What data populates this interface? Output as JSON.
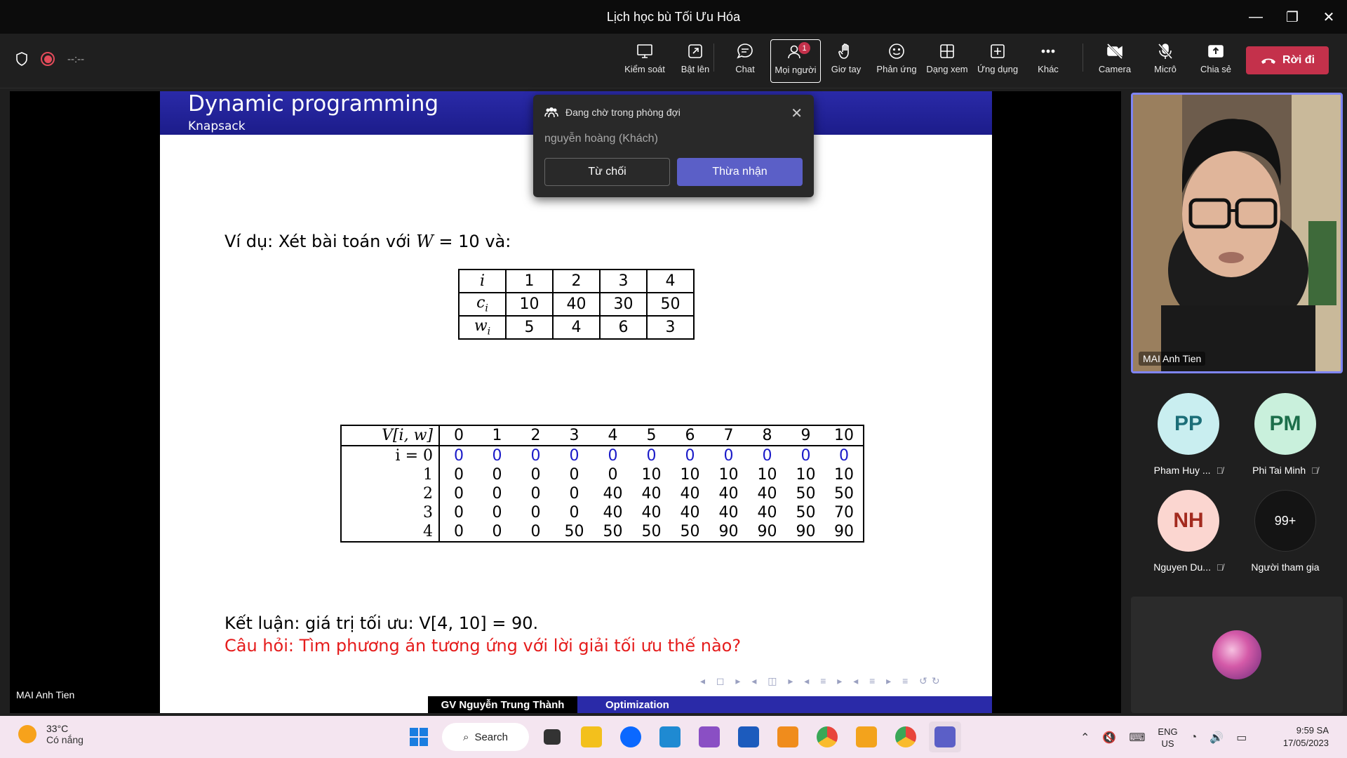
{
  "window": {
    "title": "Lịch học bù Tối Ưu Hóa",
    "controls": [
      "minimize-icon",
      "restore-icon",
      "close-icon"
    ]
  },
  "toolbar": {
    "timer": "--:--",
    "items": [
      {
        "label": "Kiểm soát",
        "icon": "control-icon"
      },
      {
        "label": "Bật lên",
        "icon": "popout-icon"
      },
      {
        "label": "Chat",
        "icon": "chat-icon"
      },
      {
        "label": "Mọi người",
        "icon": "people-icon",
        "badge": "1"
      },
      {
        "label": "Giơ tay",
        "icon": "raise-hand-icon"
      },
      {
        "label": "Phản ứng",
        "icon": "reactions-icon"
      },
      {
        "label": "Dạng xem",
        "icon": "view-icon"
      },
      {
        "label": "Ứng dụng",
        "icon": "apps-icon"
      },
      {
        "label": "Khác",
        "icon": "more-icon"
      },
      {
        "label": "Camera",
        "icon": "camera-off-icon"
      },
      {
        "label": "Micrô",
        "icon": "mic-off-icon"
      },
      {
        "label": "Chia sẻ",
        "icon": "share-icon"
      }
    ],
    "leave_label": "Rời đi",
    "colors": {
      "leave": "#c4314b",
      "active_border": "#ffffff"
    }
  },
  "slide": {
    "title": "Dynamic programming",
    "subtitle": "Knapsack",
    "example_prefix": "Ví dụ: Xét bài toán với ",
    "example_var": "W",
    "example_suffix": " = 10 và:",
    "items_table": {
      "rows": [
        {
          "head": "i",
          "cells": [
            "1",
            "2",
            "3",
            "4"
          ]
        },
        {
          "head": "c",
          "sub": "i",
          "cells": [
            "10",
            "40",
            "30",
            "50"
          ]
        },
        {
          "head": "w",
          "sub": "i",
          "cells": [
            "5",
            "4",
            "6",
            "3"
          ]
        }
      ]
    },
    "dp_table": {
      "corner": "V[i, w]",
      "columns": [
        "0",
        "1",
        "2",
        "3",
        "4",
        "5",
        "6",
        "7",
        "8",
        "9",
        "10"
      ],
      "rows": [
        {
          "label": "i = 0",
          "values": [
            "0",
            "0",
            "0",
            "0",
            "0",
            "0",
            "0",
            "0",
            "0",
            "0",
            "0"
          ],
          "highlight": true
        },
        {
          "label": "1",
          "values": [
            "0",
            "0",
            "0",
            "0",
            "0",
            "10",
            "10",
            "10",
            "10",
            "10",
            "10"
          ]
        },
        {
          "label": "2",
          "values": [
            "0",
            "0",
            "0",
            "0",
            "40",
            "40",
            "40",
            "40",
            "40",
            "50",
            "50"
          ]
        },
        {
          "label": "3",
          "values": [
            "0",
            "0",
            "0",
            "0",
            "40",
            "40",
            "40",
            "40",
            "40",
            "50",
            "70"
          ]
        },
        {
          "label": "4",
          "values": [
            "0",
            "0",
            "0",
            "50",
            "50",
            "50",
            "50",
            "90",
            "90",
            "90",
            "90"
          ]
        }
      ]
    },
    "conclusion": "Kết luận: giá trị tối ưu: V[4, 10] = 90.",
    "question": "Câu hỏi: Tìm phương án tương ứng với lời giải tối ưu thế nào?",
    "footer_author": "GV Nguyễn Trung Thành",
    "footer_topic": "Optimization",
    "colors": {
      "header": "#2a2aa8",
      "highlight": "#1a1ac8",
      "question": "#e51c1c"
    }
  },
  "presenter_label": "MAI Anh Tien",
  "lobby": {
    "heading": "Đang chờ trong phòng đợi",
    "person": "nguyễn hoàng (Khách)",
    "deny_label": "Từ chối",
    "admit_label": "Thừa nhận",
    "colors": {
      "admit": "#5b5fc7"
    }
  },
  "participants": {
    "video_name": "MAI Anh Tien",
    "tiles": [
      {
        "initials": "PP",
        "name": "Pham Huy ...",
        "color": "#c9eef0",
        "text_color": "#1b6e78"
      },
      {
        "initials": "PM",
        "name": "Phi Tai Minh",
        "color": "#c9f0dc",
        "text_color": "#1b6e4a"
      },
      {
        "initials": "NH",
        "name": "Nguyen Du...",
        "color": "#fbd6d0",
        "text_color": "#a32a1e"
      },
      {
        "initials": "99+",
        "name": "Người tham gia",
        "color": "#1f1f1f",
        "text_color": "#ffffff"
      }
    ]
  },
  "taskbar": {
    "temp": "33°C",
    "condition": "Có nắng",
    "search_label": "Search",
    "lang_top": "ENG",
    "lang_bottom": "US",
    "time": "9:59 SA",
    "date": "17/05/2023"
  }
}
